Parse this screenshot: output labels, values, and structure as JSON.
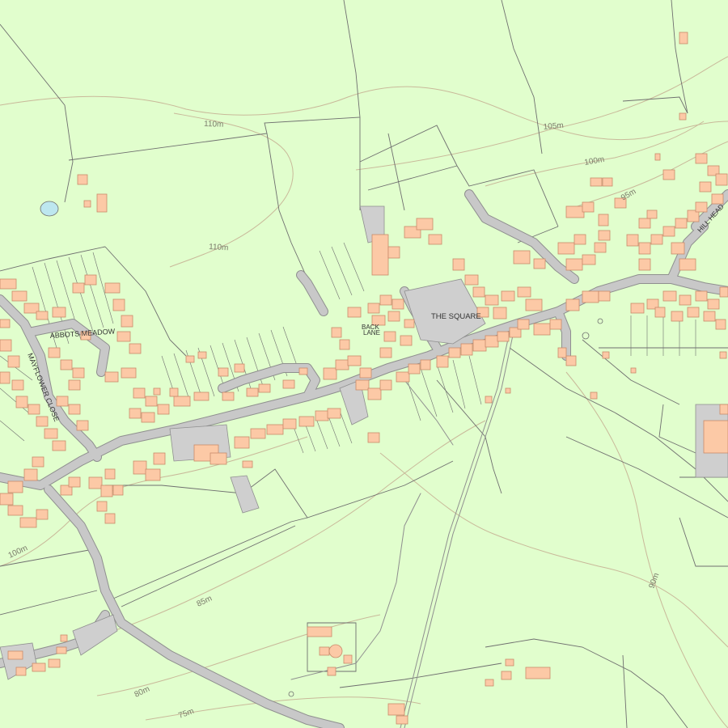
{
  "map": {
    "street_labels": {
      "the_square": "THE SQUARE",
      "back_lane_1": "BACK",
      "back_lane_2": "LANE",
      "abbots_meadow": "ABBOTS MEADOW",
      "mayflower_close": "MAYFLOWER CLOSE",
      "hill_head": "HILL HEAD"
    },
    "contour_labels": {
      "c110_top": "110m",
      "c110_mid": "110m",
      "c105": "105m",
      "c100_right": "100m",
      "c95": "95m",
      "c100_left": "100m",
      "c90": "90m",
      "c85": "85m",
      "c80": "80m",
      "c75": "75m"
    },
    "colors": {
      "land": "#e1fecd",
      "building": "#fcc9a6",
      "building_stroke": "#c98a6a",
      "road": "#c8c8c8",
      "road_edge": "#8f8f8f",
      "paved_area": "#cfcfcf",
      "boundary": "#6f6f6f",
      "contour": "#c9b99a",
      "water": "#bde7ef"
    }
  }
}
